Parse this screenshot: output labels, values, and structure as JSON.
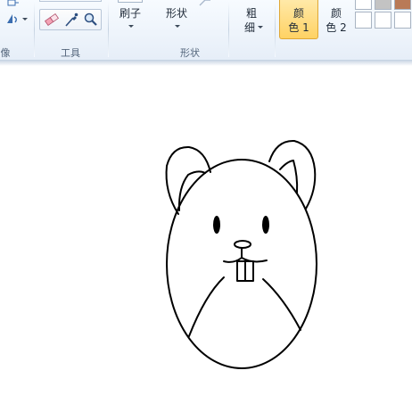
{
  "ribbon": {
    "groups": {
      "image_label": "像",
      "tools_label": "工具",
      "shapes_label": "形状"
    },
    "brushes": {
      "label": "刷子"
    },
    "shapes": {
      "label": "形状"
    },
    "size": {
      "label_line1": "粗",
      "label_line2": "细"
    },
    "color1": {
      "label_line1": "颜",
      "label_line2": "色 1",
      "active": true
    },
    "color2": {
      "label_line1": "颜",
      "label_line2": "色 2"
    },
    "palette": {
      "row1": [
        "#ffffff",
        "#c3c3c3",
        "#b97a57"
      ],
      "row2": [
        "#ffffff",
        "#ffffff",
        "#ffffff"
      ]
    }
  },
  "icons": {
    "eraser": "eraser-icon",
    "color_picker": "color-picker-icon",
    "magnifier": "magnifier-icon",
    "fill": "fill-icon",
    "select": "select-icon"
  },
  "colors": {
    "ribbon_bg": "#eef4fb",
    "active_color_button": "#ffd264",
    "drawing_stroke": "#000000",
    "canvas_bg": "#ffffff"
  }
}
